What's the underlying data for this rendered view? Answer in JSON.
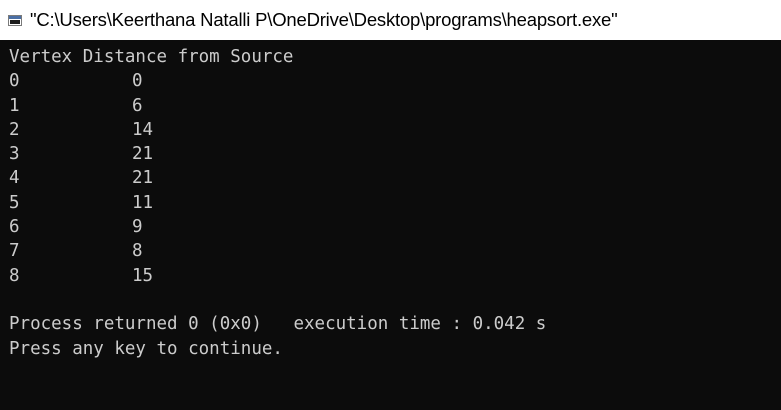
{
  "window": {
    "title": "\"C:\\Users\\Keerthana Natalli P\\OneDrive\\Desktop\\programs\\heapsort.exe\"",
    "icon": "console-icon"
  },
  "console": {
    "header": "Vertex Distance from Source",
    "rows": [
      {
        "vertex": "0",
        "distance": "0"
      },
      {
        "vertex": "1",
        "distance": "6"
      },
      {
        "vertex": "2",
        "distance": "14"
      },
      {
        "vertex": "3",
        "distance": "21"
      },
      {
        "vertex": "4",
        "distance": "21"
      },
      {
        "vertex": "5",
        "distance": "11"
      },
      {
        "vertex": "6",
        "distance": "9"
      },
      {
        "vertex": "7",
        "distance": "8"
      },
      {
        "vertex": "8",
        "distance": "15"
      }
    ],
    "process_line": "Process returned 0 (0x0)   execution time : 0.042 s",
    "continue_line": "Press any key to continue."
  },
  "colors": {
    "console_background": "#0c0c0c",
    "console_text": "#cccccc",
    "titlebar_background": "#ffffff"
  }
}
